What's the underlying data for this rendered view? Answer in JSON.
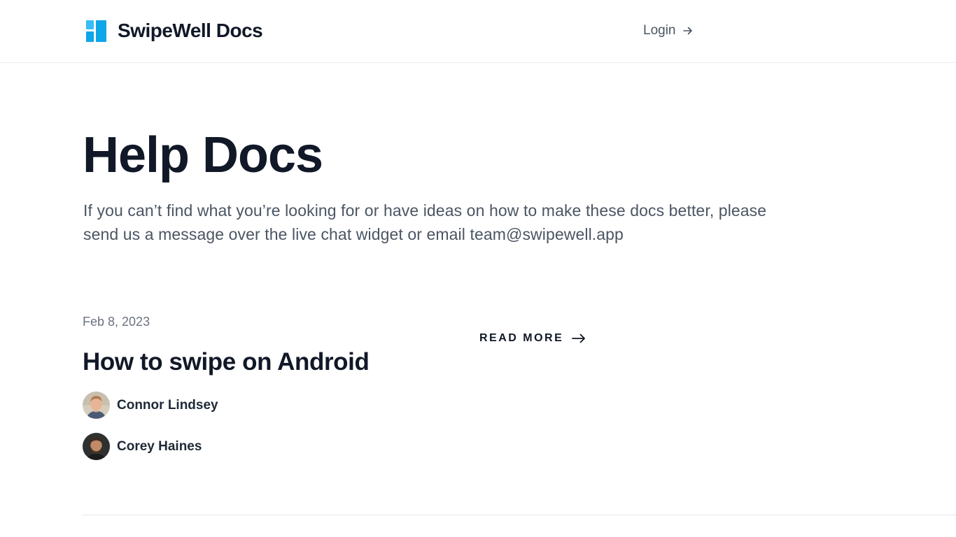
{
  "header": {
    "brand_name": "SwipeWell Docs",
    "login_label": "Login"
  },
  "hero": {
    "title": "Help Docs",
    "subtitle": "If you can’t find what you’re looking for or have ideas on how to make these docs better, please send us a message over the live chat widget or email team@swipewell.app"
  },
  "posts": [
    {
      "date": "Feb 8, 2023",
      "title": "How to swipe on Android",
      "read_more_label": "READ MORE",
      "authors": [
        {
          "name": "Connor Lindsey"
        },
        {
          "name": "Corey Haines"
        }
      ]
    }
  ],
  "colors": {
    "brand_accent": "#0ea5e9",
    "text_primary": "#111827",
    "text_muted": "#4b5563"
  },
  "icons": {
    "logo": "grid-logo-icon",
    "login": "arrow-right-icon",
    "read_more": "long-arrow-right-icon"
  }
}
